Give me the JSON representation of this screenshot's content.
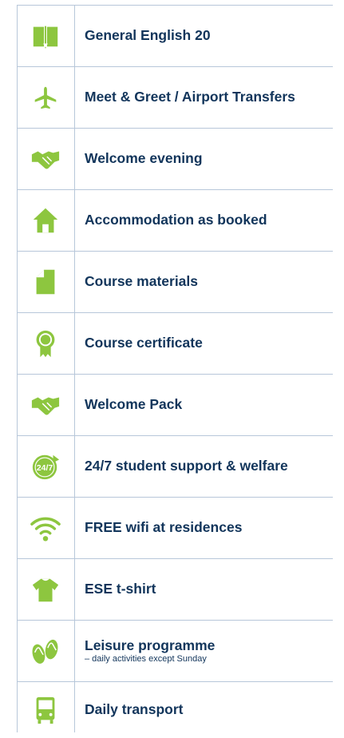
{
  "colors": {
    "icon": "#8dc63f",
    "text": "#12355b",
    "border": "#b7c7d9"
  },
  "items": [
    {
      "icon": "book-icon",
      "label": "General English 20"
    },
    {
      "icon": "airplane-icon",
      "label": "Meet & Greet / Airport Transfers"
    },
    {
      "icon": "handshake-icon",
      "label": "Welcome evening"
    },
    {
      "icon": "house-icon",
      "label": "Accommodation as booked"
    },
    {
      "icon": "document-icon",
      "label": "Course materials"
    },
    {
      "icon": "award-ribbon-icon",
      "label": "Course certificate"
    },
    {
      "icon": "handshake-icon",
      "label": "Welcome Pack"
    },
    {
      "icon": "24-7-support-icon",
      "label": "24/7 student support & welfare",
      "icon_text": "24/7"
    },
    {
      "icon": "wifi-icon",
      "label": "FREE wifi at residences"
    },
    {
      "icon": "tshirt-icon",
      "label": "ESE t-shirt"
    },
    {
      "icon": "flip-flops-icon",
      "label": "Leisure programme",
      "sublabel": "– daily activities except Sunday"
    },
    {
      "icon": "bus-icon",
      "label": "Daily transport"
    }
  ]
}
